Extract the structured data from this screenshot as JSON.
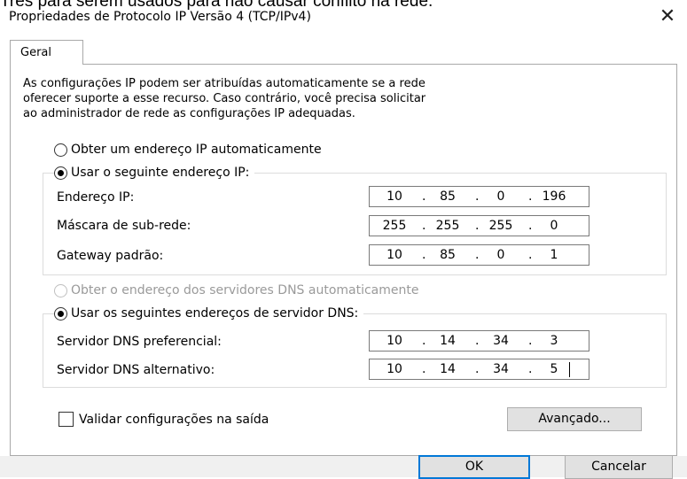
{
  "background_text": "Tres para serem usados para nao causar conflito na rede.",
  "window": {
    "title": "Propriedades de Protocolo IP Versão 4 (TCP/IPv4)",
    "close_glyph": "✕"
  },
  "tab": {
    "label": "Geral"
  },
  "intro_text": "As configurações IP podem ser atribuídas automaticamente se a rede\noferecer suporte a esse recurso. Caso contrário, você precisa solicitar\nao administrador de rede as configurações IP adequadas.",
  "ip_mode": {
    "auto_label": "Obter um endereço IP automaticamente",
    "auto_checked": false,
    "manual_label": "Usar o seguinte endereço IP:",
    "manual_checked": true,
    "fields": [
      {
        "label": "Endereço IP:",
        "octets": [
          "10",
          "85",
          "0",
          "196"
        ]
      },
      {
        "label": "Máscara de sub-rede:",
        "octets": [
          "255",
          "255",
          "255",
          "0"
        ]
      },
      {
        "label": "Gateway padrão:",
        "octets": [
          "10",
          "85",
          "0",
          "1"
        ]
      }
    ]
  },
  "dns_mode": {
    "auto_label": "Obter o endereço dos servidores DNS automaticamente",
    "auto_checked": false,
    "auto_disabled": true,
    "manual_label": "Usar os seguintes endereços de servidor DNS:",
    "manual_checked": true,
    "fields": [
      {
        "label": "Servidor DNS preferencial:",
        "octets": [
          "10",
          "14",
          "34",
          "3"
        ]
      },
      {
        "label": "Servidor DNS alternativo:",
        "octets": [
          "10",
          "14",
          "34",
          "5"
        ]
      }
    ]
  },
  "validate": {
    "label": "Validar configurações na saída",
    "checked": false
  },
  "buttons": {
    "advanced": "Avançado...",
    "ok": "OK",
    "cancel": "Cancelar"
  },
  "icons": {
    "close": "close-icon",
    "radio": "radio-icon",
    "checkbox": "checkbox-icon"
  }
}
